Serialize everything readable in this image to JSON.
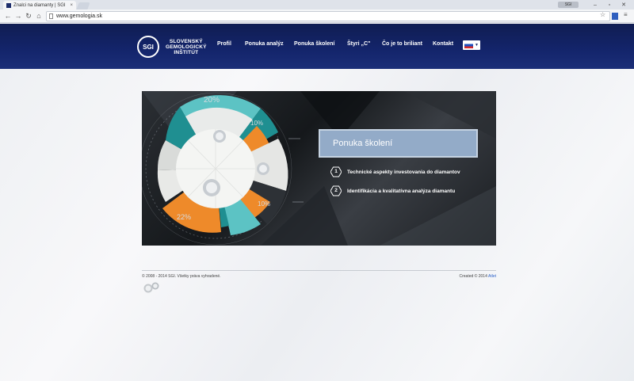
{
  "browser": {
    "tab_title": "Znalci na diamanty | SGI",
    "tab_close": "×",
    "address": "www.gemologia.sk",
    "window_user": "SGI",
    "icons": [
      "back-icon",
      "forward-icon",
      "reload-icon",
      "home-icon",
      "page-icon",
      "star-icon",
      "extension-icon",
      "menu-icon"
    ]
  },
  "header": {
    "logo_mark": "SGI",
    "logo_line1": "SLOVENSKÝ",
    "logo_line2": "GEMOLOGICKÝ",
    "logo_line3": "INŠTITÚT",
    "menu": [
      "Profil",
      "Ponuka analýz",
      "Ponuka školení",
      "Štyri „C\"",
      "Čo je to briliant",
      "Kontakt"
    ]
  },
  "banner": {
    "percent_top": "20%",
    "percent_right": "10%",
    "percent_bottom_right": "10%",
    "percent_bottom_left": "22%",
    "offer_title": "Ponuka školení",
    "items": [
      {
        "num": "1",
        "text": "Technické aspekty investovania do diamantov"
      },
      {
        "num": "2",
        "text": "Identifikácia a kvalitatívna analýza diamantu"
      }
    ],
    "colors": {
      "teal": "#5cc3c4",
      "orange": "#ee8a2a",
      "dark_teal": "#1f8f91",
      "offer": "#93abc8"
    }
  },
  "footer": {
    "copyright": "© 2008 - 2014 SGI. Všetky práva vyhradené.",
    "created_prefix": "Created © 2014",
    "created_link": "Atlet"
  }
}
